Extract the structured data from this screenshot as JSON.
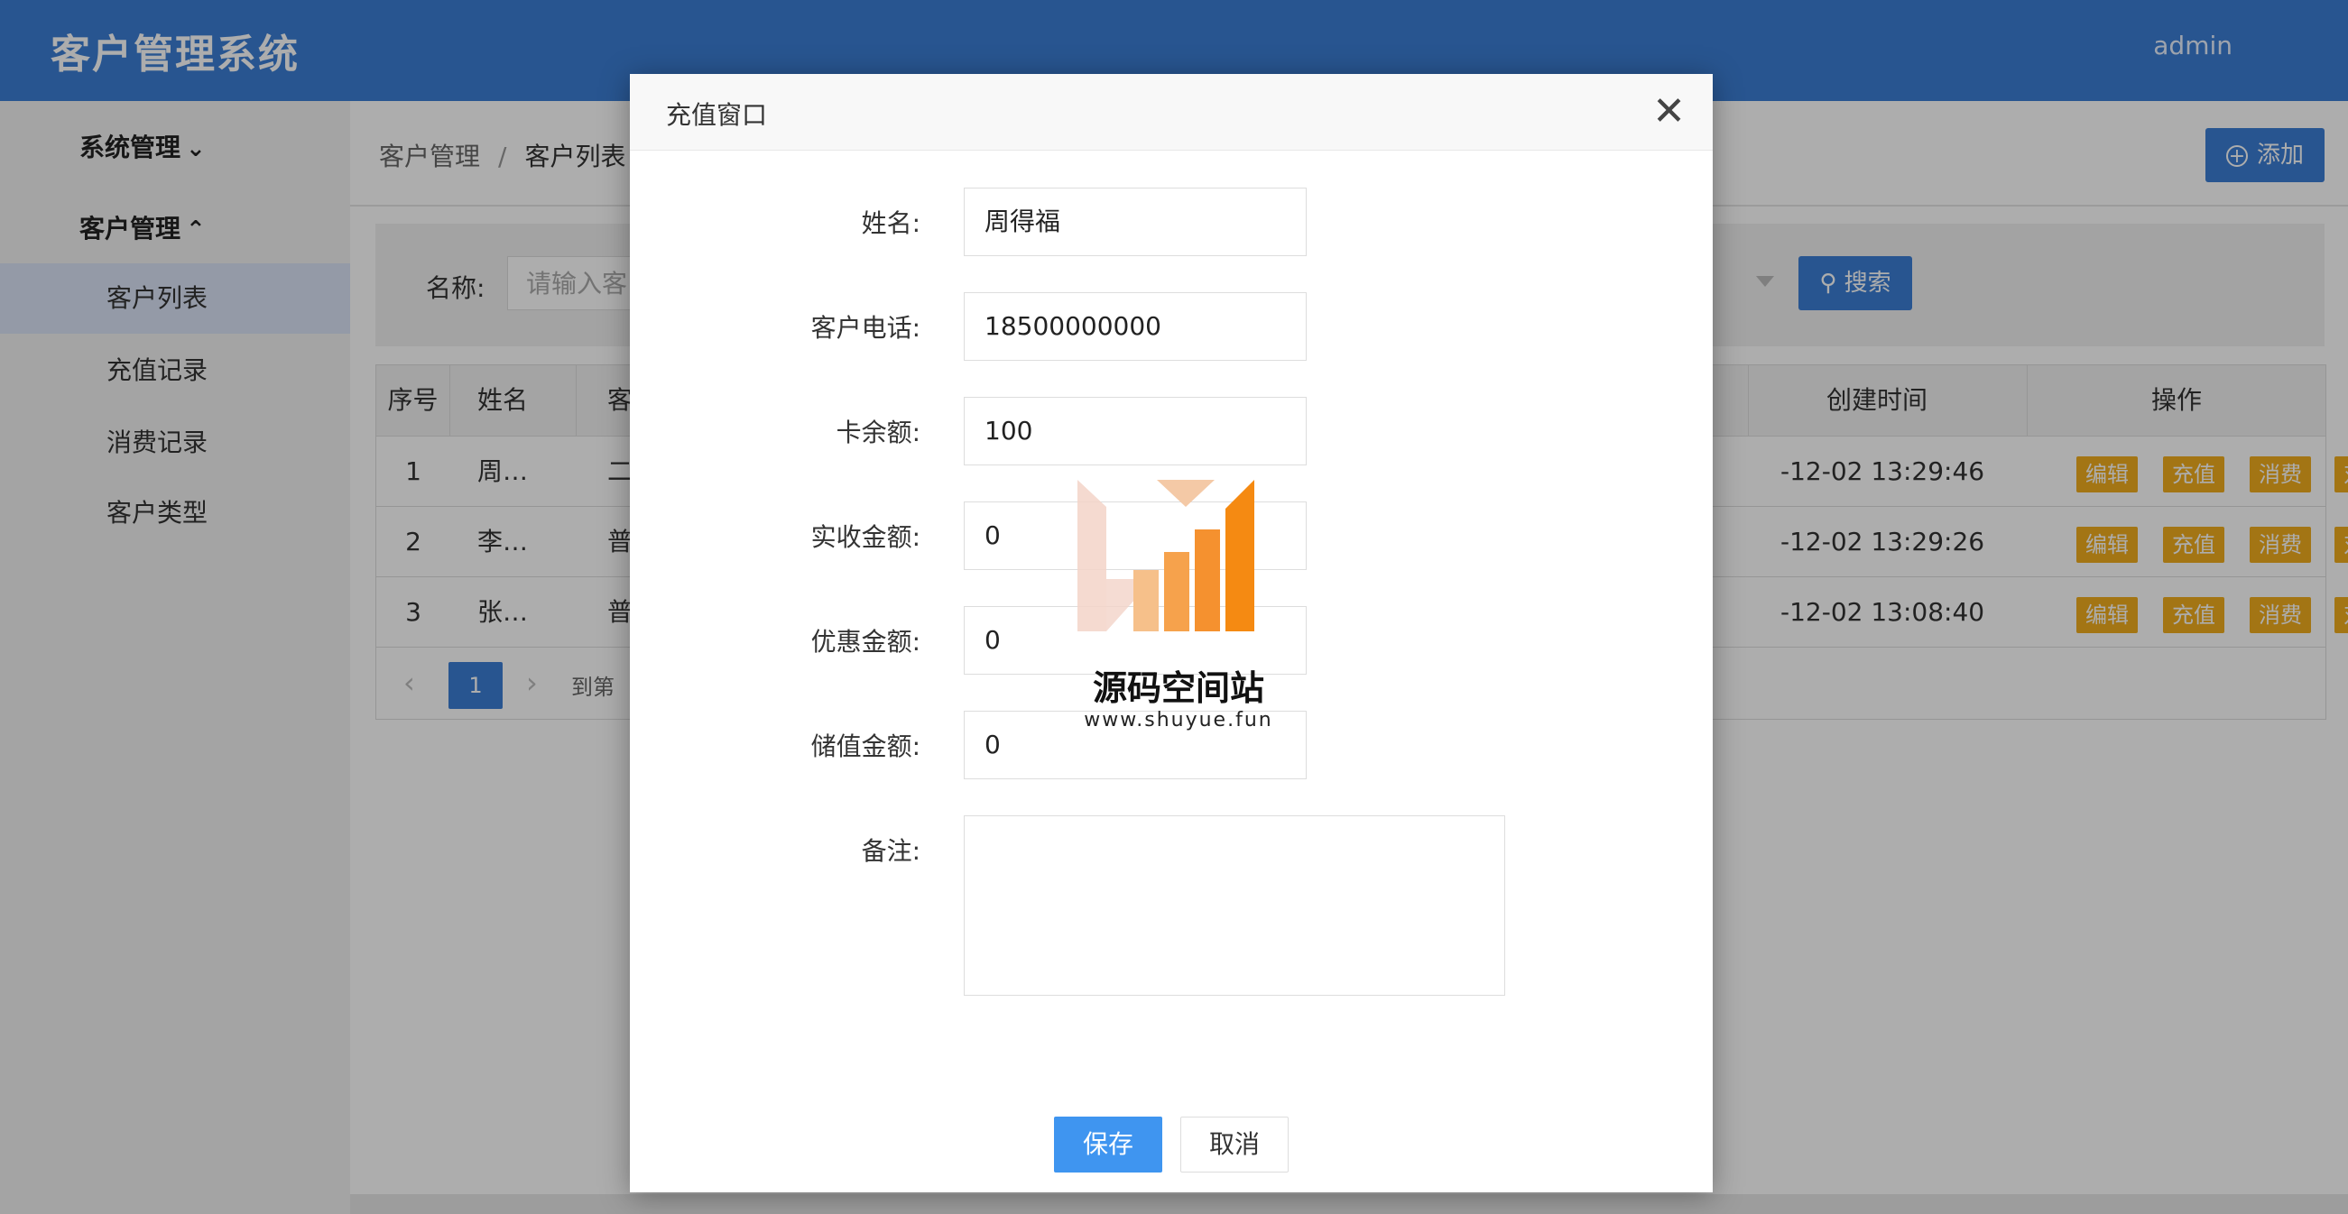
{
  "header": {
    "title": "客户管理系统",
    "user": "admin"
  },
  "sidebar": {
    "groups": [
      {
        "label": "系统管理",
        "chevron": "chevron-down-icon"
      },
      {
        "label": "客户管理",
        "chevron": "chevron-up-icon"
      }
    ],
    "items": [
      {
        "label": "客户列表",
        "active": true
      },
      {
        "label": "充值记录"
      },
      {
        "label": "消费记录"
      },
      {
        "label": "客户类型"
      }
    ]
  },
  "main": {
    "breadcrumb": [
      "客户管理",
      "/",
      "客户列表"
    ],
    "add_button": "添加",
    "search": {
      "label": "名称:",
      "placeholder": "请输入客",
      "button": "搜索"
    },
    "table": {
      "headers": [
        "序号",
        "姓名",
        "客",
        "创建时间",
        "操作"
      ],
      "rows": [
        {
          "no": "1",
          "name": "周…",
          "type": "二",
          "time": "-12-02 13:29:46"
        },
        {
          "no": "2",
          "name": "李…",
          "type": "普",
          "time": "-12-02 13:29:26"
        },
        {
          "no": "3",
          "name": "张…",
          "type": "普",
          "time": "-12-02 13:08:40"
        }
      ],
      "actions": [
        "编辑",
        "充值",
        "消费",
        "对账单"
      ]
    },
    "pager": {
      "current": "1",
      "goto": "到第"
    }
  },
  "modal": {
    "title": "充值窗口",
    "fields": [
      {
        "label": "姓名:",
        "value": "周得福"
      },
      {
        "label": "客户电话:",
        "value": "18500000000"
      },
      {
        "label": "卡余额:",
        "value": "100"
      },
      {
        "label": "实收金额:",
        "value": "0"
      },
      {
        "label": "优惠金额:",
        "value": "0"
      },
      {
        "label": "储值金额:",
        "value": "0"
      }
    ],
    "remark_label": "备注:",
    "remark_value": "",
    "save": "保存",
    "cancel": "取消"
  },
  "watermark": {
    "name": "源码空间站",
    "url": "www.shuyue.fun"
  },
  "colors": {
    "primary": "#3b7ed4",
    "warning": "#f0ad1e",
    "save": "#3f95f0"
  }
}
